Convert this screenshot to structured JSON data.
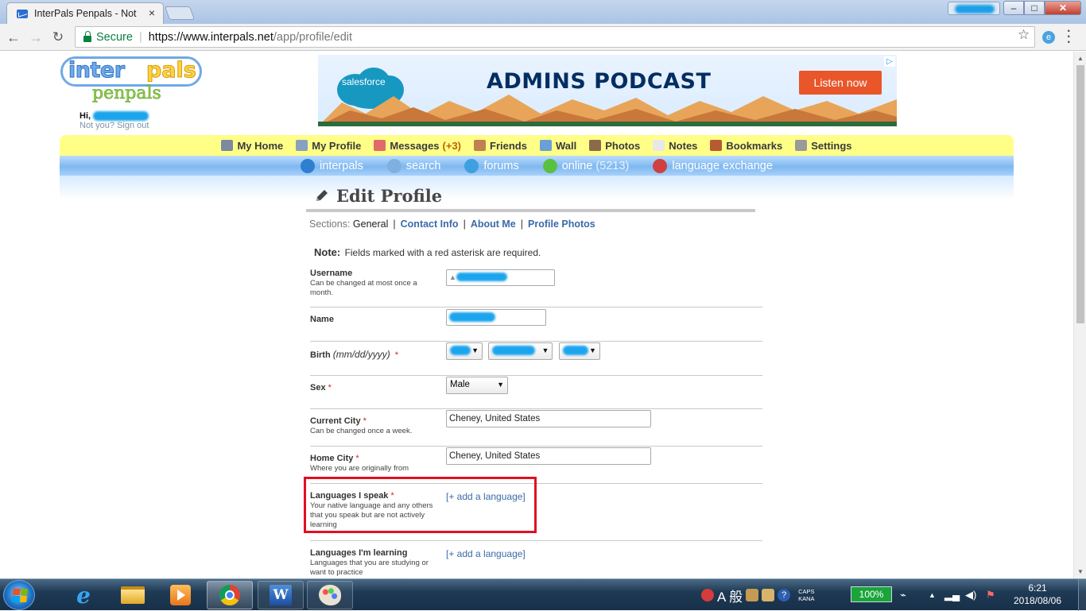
{
  "browser": {
    "tab_title": "InterPals Penpals - Not",
    "tab_close": "×",
    "secure_label": "Secure",
    "url_host": "https://www.interpals.net",
    "url_path": "/app/profile/edit",
    "window_buttons": {
      "minimize": "–",
      "maximize": "□",
      "close": "✕"
    }
  },
  "header": {
    "logo_inter": "inter",
    "logo_pals": "pals",
    "logo_penpals": "penpals",
    "greeting": "Hi,",
    "not_you": "Not you? Sign out"
  },
  "ad": {
    "brand": "salesforce",
    "title": "ADMINS PODCAST",
    "cta": "Listen now",
    "mark": "▷"
  },
  "nav_primary": [
    {
      "label": "My Home",
      "icon": "home-icon",
      "color": "#7a8aa0"
    },
    {
      "label": "My Profile",
      "icon": "profile-icon",
      "color": "#8aa0c0"
    },
    {
      "label": "Messages",
      "count": "(+3)",
      "icon": "envelope-icon",
      "color": "#e06a6a"
    },
    {
      "label": "Friends",
      "icon": "friends-icon",
      "color": "#c08050"
    },
    {
      "label": "Wall",
      "icon": "wall-icon",
      "color": "#6aa0d8"
    },
    {
      "label": "Photos",
      "icon": "photos-icon",
      "color": "#8a6a4a"
    },
    {
      "label": "Notes",
      "icon": "notes-icon",
      "color": "#e8e8e8"
    },
    {
      "label": "Bookmarks",
      "icon": "bookmark-icon",
      "color": "#b85a30"
    },
    {
      "label": "Settings",
      "icon": "settings-icon",
      "color": "#9a9a9a"
    }
  ],
  "nav_secondary": [
    {
      "label": "interpals",
      "icon": "globe-icon",
      "color": "#2f7fd0"
    },
    {
      "label": "search",
      "icon": "search-icon",
      "color": "#7fb0e0"
    },
    {
      "label": "forums",
      "icon": "speech-bubble-icon",
      "color": "#3fa0e0"
    },
    {
      "label": "online",
      "count": "(5213)",
      "icon": "online-icon",
      "color": "#5ac040"
    },
    {
      "label": "language exchange",
      "icon": "language-flags-icon",
      "color": "#d04040"
    }
  ],
  "content": {
    "title": "Edit Profile",
    "sections_label": "Sections:",
    "sections": [
      {
        "label": "General",
        "current": true
      },
      {
        "label": "Contact Info",
        "current": false
      },
      {
        "label": "About Me",
        "current": false
      },
      {
        "label": "Profile Photos",
        "current": false
      }
    ],
    "note_label": "Note:",
    "note_text": "Fields marked with a red asterisk are required.",
    "fields": {
      "username": {
        "label": "Username",
        "hint": "Can be changed at most once a month."
      },
      "name": {
        "label": "Name"
      },
      "birth": {
        "label": "Birth",
        "format": "(mm/dd/yyyy)",
        "required": "*"
      },
      "sex": {
        "label": "Sex",
        "required": "*",
        "value": "Male"
      },
      "current_city": {
        "label": "Current City",
        "required": "*",
        "hint": "Can be changed once a week.",
        "value": "Cheney, United States"
      },
      "home_city": {
        "label": "Home City",
        "required": "*",
        "hint": "Where you are originally from",
        "value": "Cheney, United States"
      },
      "languages_speak": {
        "label": "Languages I speak",
        "required": "*",
        "hint": "Your native language and any others that you speak but are not actively learning",
        "action": "[+ add a language]"
      },
      "languages_learning": {
        "label": "Languages I'm learning",
        "hint": "Languages that you are studying or want to practice",
        "action": "[+ add a language]"
      }
    }
  },
  "taskbar": {
    "ime": "A 般",
    "caps": "CAPS",
    "kana": "KANA",
    "battery": "100%",
    "time": "6:21",
    "date": "2018/08/06"
  }
}
